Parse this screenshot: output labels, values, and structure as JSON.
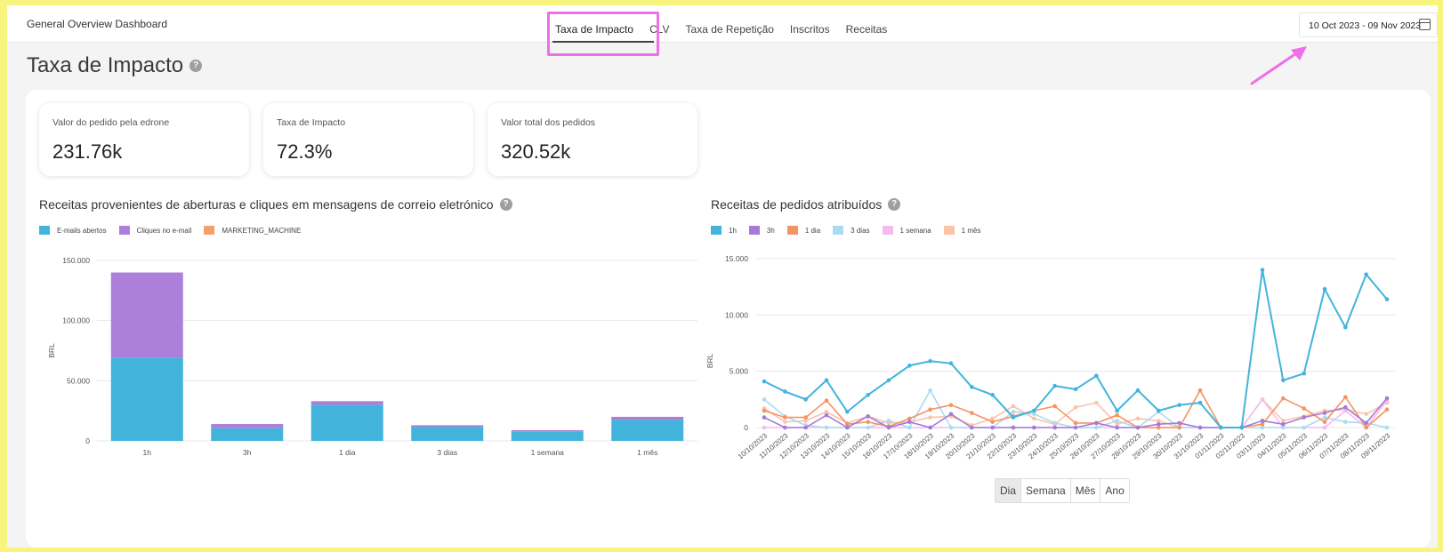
{
  "app": {
    "title": "General Overview Dashboard"
  },
  "tabs": [
    {
      "label": "Taxa de Impacto",
      "active": true
    },
    {
      "label": "CLV",
      "active": false
    },
    {
      "label": "Taxa de Repetição",
      "active": false
    },
    {
      "label": "Inscritos",
      "active": false
    },
    {
      "label": "Receitas",
      "active": false
    }
  ],
  "date_range": {
    "value": "10 Oct 2023 - 09 Nov 2023",
    "icon": "calendar-icon"
  },
  "page": {
    "heading": "Taxa de Impacto",
    "help_icon": "?"
  },
  "kpis": [
    {
      "label": "Valor do pedido pela edrone",
      "value": "231.76k"
    },
    {
      "label": "Taxa de Impacto",
      "value": "72.3%"
    },
    {
      "label": "Valor total dos pedidos",
      "value": "320.52k"
    }
  ],
  "colors": {
    "opened": "#42b4dc",
    "clicks": "#ab7fda",
    "marketing": "#f5a06b",
    "h1": "#42b4dc",
    "h3": "#a57ad8",
    "d1": "#f59361",
    "d3": "#a9dbf3",
    "w1": "#f6b9f1",
    "m1": "#fbc3a9",
    "highlight": "#ee6fe6"
  },
  "chart_data": [
    {
      "type": "bar",
      "title": "Receitas provenientes de aberturas e cliques em mensagens de correio eletrónico",
      "ylabel": "BRL",
      "stacked": true,
      "categories": [
        "1h",
        "3h",
        "1 dia",
        "3 dias",
        "1 semana",
        "1 mês"
      ],
      "ylim": [
        0,
        150000
      ],
      "yticks": [
        "0",
        "50.000",
        "100.000",
        "150.000"
      ],
      "series": [
        {
          "name": "E-mails abertos",
          "values": [
            69000,
            10500,
            30000,
            11800,
            8000,
            17500
          ]
        },
        {
          "name": "Cliques no e-mail",
          "values": [
            71000,
            3500,
            3000,
            1200,
            900,
            2500
          ]
        },
        {
          "name": "MARKETING_MACHINE",
          "values": [
            0,
            0,
            0,
            0,
            0,
            0
          ]
        }
      ]
    },
    {
      "type": "line",
      "title": "Receitas de pedidos atribuídos",
      "ylabel": "BRL",
      "ylim": [
        0,
        15000
      ],
      "yticks": [
        "0",
        "5.000",
        "10.000",
        "15.000"
      ],
      "x": [
        "10/10/2023",
        "11/10/2023",
        "12/10/2023",
        "13/10/2023",
        "14/10/2023",
        "15/10/2023",
        "16/10/2023",
        "17/10/2023",
        "18/10/2023",
        "19/10/2023",
        "20/10/2023",
        "21/10/2023",
        "22/10/2023",
        "23/10/2023",
        "24/10/2023",
        "25/10/2023",
        "26/10/2023",
        "27/10/2023",
        "28/10/2023",
        "29/10/2023",
        "30/10/2023",
        "31/10/2023",
        "01/11/2023",
        "02/11/2023",
        "03/11/2023",
        "04/11/2023",
        "05/11/2023",
        "06/11/2023",
        "07/11/2023",
        "08/11/2023",
        "09/11/2023"
      ],
      "series": [
        {
          "name": "1h",
          "values": [
            4100,
            3200,
            2500,
            4200,
            1400,
            2900,
            4200,
            5500,
            5900,
            5700,
            3600,
            2900,
            900,
            1500,
            3700,
            3400,
            4600,
            1500,
            3300,
            1500,
            2000,
            2200,
            0,
            0,
            14000,
            4200,
            4800,
            12300,
            8900,
            13600,
            11400
          ]
        },
        {
          "name": "3h",
          "values": [
            900,
            0,
            0,
            1100,
            0,
            1000,
            0,
            500,
            0,
            1200,
            0,
            0,
            0,
            0,
            0,
            0,
            400,
            0,
            0,
            300,
            400,
            0,
            0,
            0,
            600,
            300,
            900,
            1300,
            1800,
            400,
            2600
          ]
        },
        {
          "name": "1 dia",
          "values": [
            1500,
            900,
            900,
            2400,
            300,
            500,
            100,
            800,
            1600,
            2000,
            1300,
            500,
            1000,
            1500,
            1900,
            400,
            400,
            1100,
            0,
            0,
            0,
            3300,
            0,
            0,
            300,
            2600,
            1700,
            500,
            2700,
            0,
            1600
          ]
        },
        {
          "name": "3 dias",
          "values": [
            2500,
            1000,
            200,
            0,
            0,
            0,
            600,
            0,
            3300,
            0,
            0,
            0,
            1400,
            1200,
            400,
            0,
            0,
            600,
            0,
            1400,
            0,
            0,
            0,
            0,
            0,
            0,
            0,
            900,
            500,
            400,
            0
          ]
        },
        {
          "name": "1 semana",
          "values": [
            0,
            0,
            0,
            0,
            0,
            0,
            0,
            0,
            0,
            0,
            0,
            0,
            0,
            0,
            0,
            0,
            0,
            0,
            0,
            0,
            0,
            0,
            0,
            0,
            2500,
            0,
            0,
            0,
            1500,
            0,
            2400
          ]
        },
        {
          "name": "1 mês",
          "values": [
            1700,
            500,
            600,
            1400,
            400,
            1000,
            400,
            500,
            900,
            1000,
            200,
            800,
            1900,
            800,
            300,
            1800,
            2200,
            300,
            800,
            600,
            0,
            0,
            0,
            0,
            2500,
            600,
            1000,
            1500,
            1600,
            1200,
            2200
          ]
        }
      ]
    }
  ],
  "granularity": [
    {
      "label": "Dia",
      "active": true
    },
    {
      "label": "Semana",
      "active": false
    },
    {
      "label": "Mês",
      "active": false
    },
    {
      "label": "Ano",
      "active": false
    }
  ]
}
